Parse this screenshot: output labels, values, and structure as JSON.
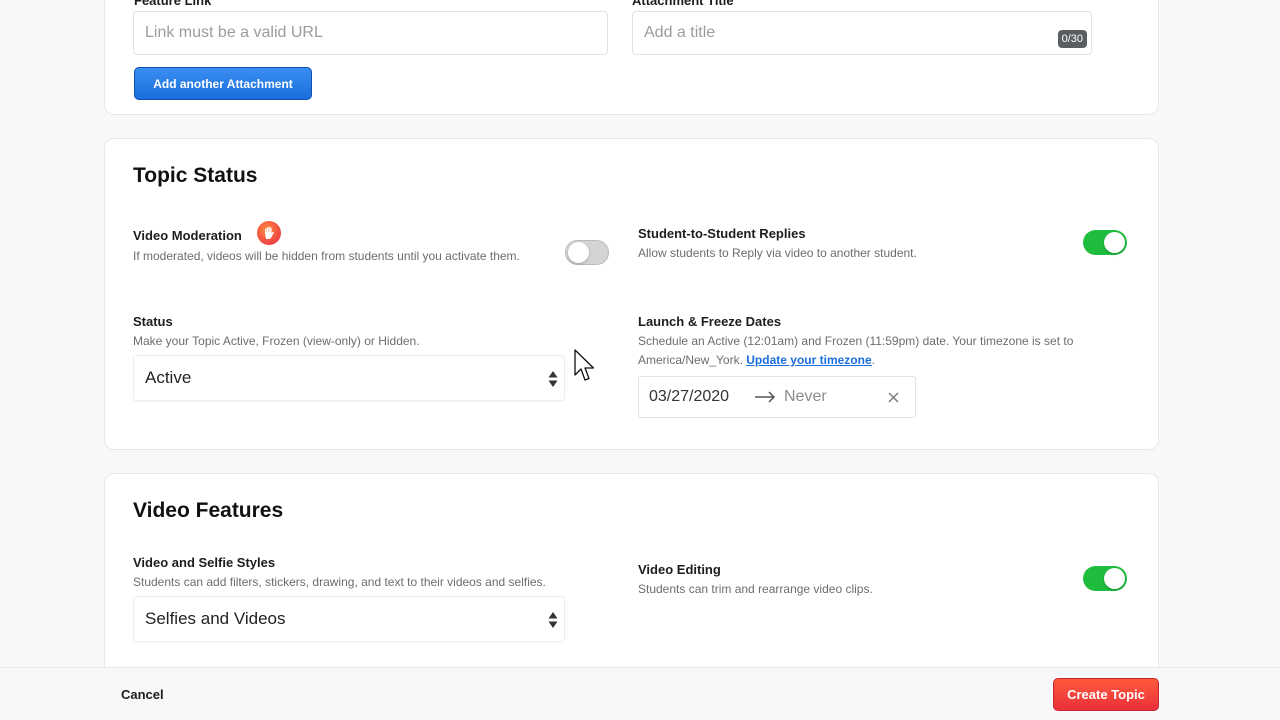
{
  "attachments": {
    "feature_link_label": "Feature Link",
    "feature_link_placeholder": "Link must be a valid URL",
    "attachment_title_label": "Attachment Title",
    "attachment_title_placeholder": "Add a title",
    "attachment_title_counter": "0/30",
    "add_button": "Add another Attachment"
  },
  "topic_status": {
    "title": "Topic Status",
    "video_moderation": {
      "label": "Video Moderation",
      "description": "If moderated, videos will be hidden from students until you activate them.",
      "enabled": false,
      "icon": "raised-hand-icon"
    },
    "student_replies": {
      "label": "Student-to-Student Replies",
      "description": "Allow students to Reply via video to another student.",
      "enabled": true
    },
    "status": {
      "label": "Status",
      "description": "Make your Topic Active, Frozen (view-only) or Hidden.",
      "value": "Active"
    },
    "dates": {
      "label": "Launch & Freeze Dates",
      "description_prefix": "Schedule an Active (12:01am) and Frozen (11:59pm) date. Your timezone is set to America/New_York. ",
      "timezone_link": "Update your timezone",
      "description_suffix": ".",
      "launch": "03/27/2020",
      "freeze": "Never"
    }
  },
  "video_features": {
    "title": "Video Features",
    "styles": {
      "label": "Video and Selfie Styles",
      "description": "Students can add filters, stickers, drawing, and text to their videos and selfies.",
      "value": "Selfies and Videos"
    },
    "editing": {
      "label": "Video Editing",
      "description": "Students can trim and rearrange video clips.",
      "enabled": true
    }
  },
  "footer": {
    "cancel": "Cancel",
    "create": "Create Topic"
  },
  "colors": {
    "toggle_on": "#1fbd3e",
    "primary_blue": "#1a6fdc",
    "create_red": "#e9303b"
  }
}
